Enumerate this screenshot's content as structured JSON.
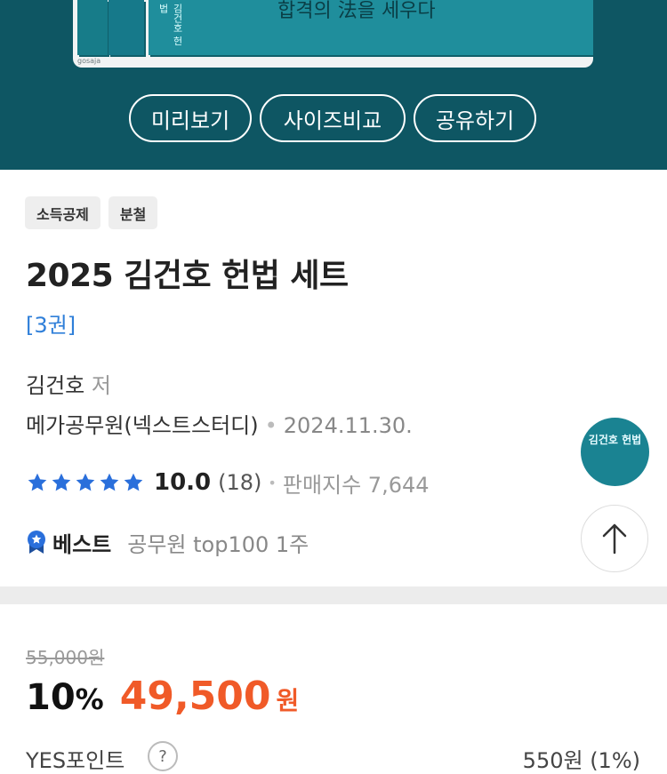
{
  "hero": {
    "tagline": "합격의 法을 세우다",
    "publisher_mark": "gosaja",
    "spine_text": "김건호 헌법",
    "buttons": [
      "미리보기",
      "사이즈비교",
      "공유하기"
    ],
    "background": "#0e5663"
  },
  "tags": [
    "소득공제",
    "분철"
  ],
  "product": {
    "title": "2025 김건호 헌법 세트",
    "volumes": "[3권]",
    "author": "김건호",
    "author_suffix": "저",
    "publisher": "메가공무원(넥스트스터디)",
    "pub_date": "2024.11.30."
  },
  "rating": {
    "stars": 5,
    "score": "10.0",
    "count": "(18)",
    "sales_index": "판매지수 7,644"
  },
  "best": {
    "label": "베스트",
    "rank": "공무원 top100 1주"
  },
  "thumbnail": {
    "text": "김건호 헌법"
  },
  "price": {
    "original": "55,000원",
    "discount": "10",
    "discount_unit": "%",
    "sale": "49,500",
    "unit": "원",
    "accent_color": "#f05a28"
  },
  "points": {
    "label": "YES포인트",
    "help": "?",
    "value": "550원 (1%)"
  },
  "icons": [
    "star-icon",
    "best-badge-icon",
    "arrow-up-icon",
    "help-icon"
  ]
}
